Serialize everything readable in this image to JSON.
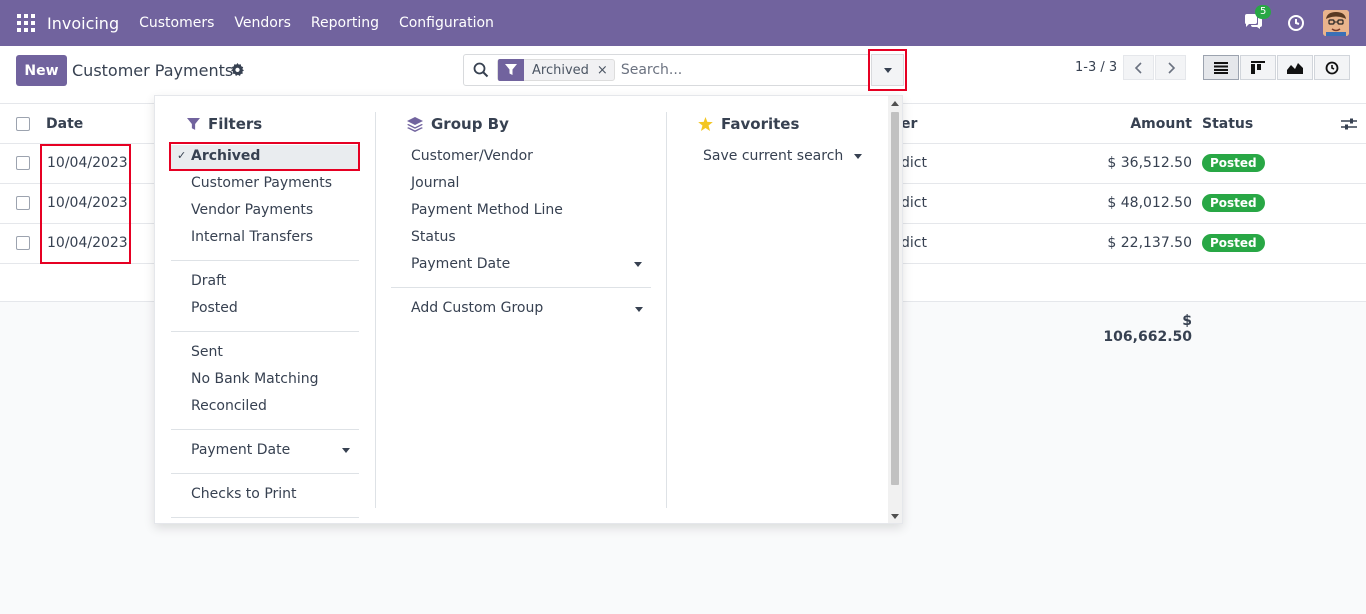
{
  "navbar": {
    "app_name": "Invoicing",
    "menu": [
      "Customers",
      "Vendors",
      "Reporting",
      "Configuration"
    ],
    "chat_count": "5"
  },
  "control_panel": {
    "new_label": "New",
    "title": "Customer Payments",
    "search": {
      "facet_label": "Archived",
      "facet_remove": "×",
      "placeholder": "Search..."
    },
    "pager": "1-3 / 3"
  },
  "list": {
    "headers": {
      "date": "Date",
      "partner_tail": "er",
      "amount": "Amount",
      "status": "Status"
    },
    "rows": [
      {
        "date": "10/04/2023",
        "partner_tail": "dict",
        "amount": "$ 36,512.50",
        "status": "Posted"
      },
      {
        "date": "10/04/2023",
        "partner_tail": "dict",
        "amount": "$ 48,012.50",
        "status": "Posted"
      },
      {
        "date": "10/04/2023",
        "partner_tail": "dict",
        "amount": "$ 22,137.50",
        "status": "Posted"
      }
    ],
    "total": "$ 106,662.50"
  },
  "dropdown": {
    "filters": {
      "title": "Filters",
      "check_mark": "✓",
      "items": [
        "Archived",
        "Customer Payments",
        "Vendor Payments",
        "Internal Transfers",
        "Draft",
        "Posted",
        "Sent",
        "No Bank Matching",
        "Reconciled",
        "Payment Date",
        "Checks to Print"
      ]
    },
    "group_by": {
      "title": "Group By",
      "items": [
        "Customer/Vendor",
        "Journal",
        "Payment Method Line",
        "Status",
        "Payment Date",
        "Add Custom Group"
      ]
    },
    "favorites": {
      "title": "Favorites",
      "items": [
        "Save current search"
      ]
    }
  },
  "colors": {
    "brand": "#71639e",
    "success": "#28a745",
    "highlight": "#e60023"
  }
}
